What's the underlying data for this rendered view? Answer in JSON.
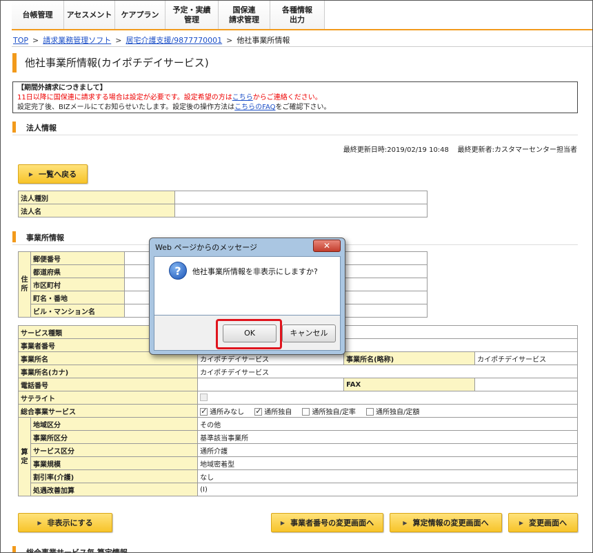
{
  "nav": [
    "台帳管理",
    "アセスメント",
    "ケアプラン",
    "予定・実績\n管理",
    "国保連\n請求管理",
    "各種情報\n出力"
  ],
  "breadcrumb": {
    "top": "TOP",
    "billing": "請求業務管理ソフト",
    "office": "居宅介護支援/9877770001",
    "current": "他社事業所情報",
    "sep": ">"
  },
  "page_title": "他社事業所情報(カイポチデイサービス)",
  "notice": {
    "title": "【期間外請求につきまして】",
    "line1_before": "11日以降に国保連に請求する場合は設定が必要です。設定希望の方は",
    "line1_link": "こちら",
    "line1_after": "からご連絡ください。",
    "line2_before": "設定完了後、BIZメールにてお知らせいたします。設定後の操作方法は",
    "line2_link": "こちらのFAQ",
    "line2_after": "をご確認下さい。"
  },
  "sections": {
    "corp": "法人情報",
    "office": "事業所情報",
    "bottom": "総合事業サービス毎 算定情報"
  },
  "meta": {
    "updated_label": "最終更新日時:",
    "updated_value": "2019/02/19 10:48",
    "updater_label": "最終更新者:",
    "updater_value": "カスタマーセンター担当者"
  },
  "buttons": {
    "back": "一覧へ戻る",
    "hide": "非表示にする",
    "change_number": "事業者番号の変更画面へ",
    "change_calc": "算定情報の変更画面へ",
    "change": "変更画面へ"
  },
  "corp_table": [
    {
      "label": "法人種別",
      "value": ""
    },
    {
      "label": "法人名",
      "value": ""
    }
  ],
  "address": {
    "group": "住\n所",
    "rows": [
      "郵便番号",
      "都道府県",
      "市区町村",
      "町名・番地",
      "ビル・マンション名"
    ]
  },
  "office_table": {
    "service_type": "サービス種類",
    "office_number": "事業者番号",
    "office_name": "事業所名",
    "office_name_value": "カイポチデイサービス",
    "office_short": "事業所名(略称)",
    "office_short_value": "カイポチデイサービス",
    "office_kana": "事業所名(カナ)",
    "office_kana_value": "カイポチデイサービス",
    "phone": "電話番号",
    "fax": "FAX",
    "satellite": "サテライト",
    "general_service": "総合事業サービス",
    "options": [
      {
        "label": "通所みなし",
        "checked": true
      },
      {
        "label": "通所独自",
        "checked": true
      },
      {
        "label": "通所独自/定率",
        "checked": false
      },
      {
        "label": "通所独自/定額",
        "checked": false
      }
    ],
    "calc_group": "算\n定",
    "calc_rows": [
      {
        "label": "地域区分",
        "value": "その他"
      },
      {
        "label": "事業所区分",
        "value": "基準該当事業所"
      },
      {
        "label": "サービス区分",
        "value": "通所介護"
      },
      {
        "label": "事業規模",
        "value": "地域密着型"
      },
      {
        "label": "割引率(介護)",
        "value": "なし"
      },
      {
        "label": "処遇改善加算",
        "value": "(Ⅰ)"
      }
    ]
  },
  "dialog": {
    "title": "Web ページからのメッセージ",
    "close": "✕",
    "icon": "?",
    "message": "他社事業所情報を非表示にしますか?",
    "ok": "OK",
    "cancel": "キャンセル"
  },
  "colors": {
    "accent": "#f29a1b",
    "label_bg": "#fcf6c4",
    "button": "#f7c42a",
    "highlight": "#e0141d",
    "link": "#1a4ec7"
  }
}
